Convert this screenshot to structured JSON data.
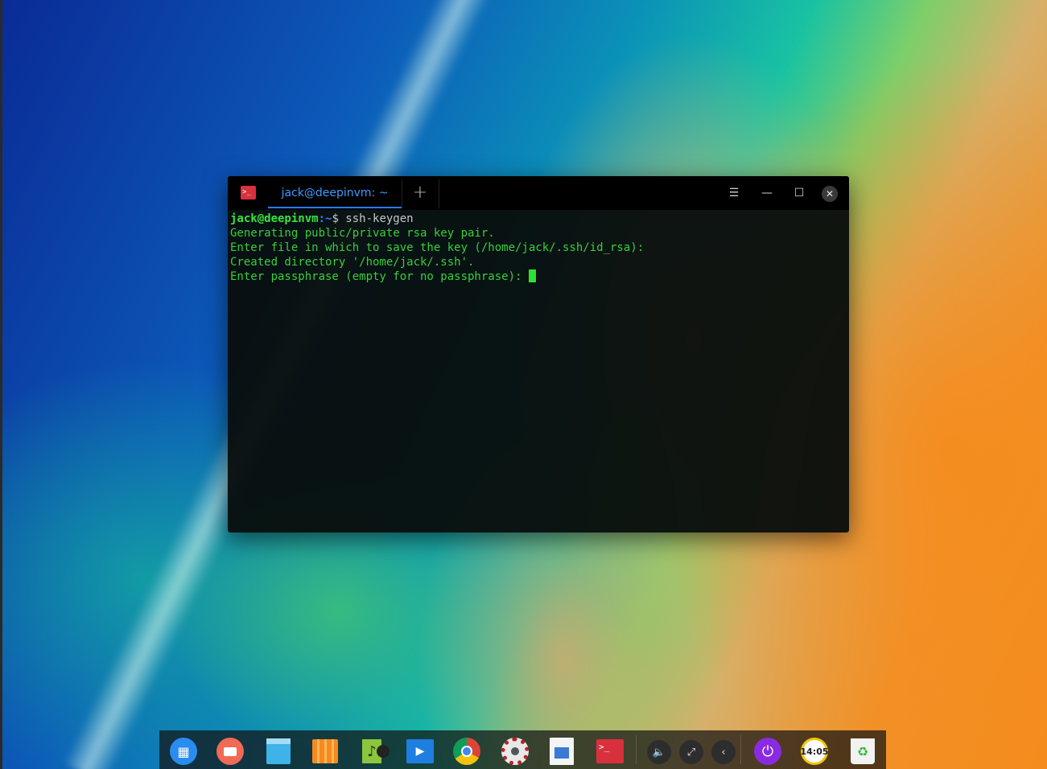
{
  "terminal": {
    "tab_title": "jack@deepinvm: ~",
    "new_tab_label": "+",
    "controls": {
      "menu": "☰",
      "minimize": "—",
      "maximize": "☐",
      "close": "✕"
    },
    "prompt": {
      "user_host": "jack@deepinvm",
      "path": ":~",
      "symbol": "$ ",
      "command": "ssh-keygen"
    },
    "output_lines": [
      "Generating public/private rsa key pair.",
      "Enter file in which to save the key (/home/jack/.ssh/id_rsa):",
      "Created directory '/home/jack/.ssh'.",
      "Enter passphrase (empty for no passphrase): "
    ]
  },
  "dock": {
    "clock_text": "14:05",
    "items": [
      {
        "name": "launcher",
        "icon": "grid-icon"
      },
      {
        "name": "multitasking-view",
        "icon": "multitask-icon"
      },
      {
        "name": "file-manager",
        "icon": "folder-icon"
      },
      {
        "name": "app-store",
        "icon": "store-icon"
      },
      {
        "name": "music",
        "icon": "music-icon"
      },
      {
        "name": "movie",
        "icon": "movie-icon"
      },
      {
        "name": "chrome",
        "icon": "chrome-icon"
      },
      {
        "name": "control-center",
        "icon": "gear-icon"
      },
      {
        "name": "image-viewer",
        "icon": "image-viewer-icon"
      },
      {
        "name": "terminal",
        "icon": "terminal-icon"
      },
      {
        "name": "volume",
        "icon": "volume-icon"
      },
      {
        "name": "network",
        "icon": "network-icon"
      },
      {
        "name": "collapse-tray",
        "icon": "chevron-left-icon"
      },
      {
        "name": "power",
        "icon": "power-icon"
      },
      {
        "name": "clock",
        "icon": "clock-icon"
      },
      {
        "name": "trash",
        "icon": "trash-icon"
      }
    ]
  },
  "colors": {
    "terminal_text": "#37d039",
    "prompt_path": "#3c7cf0",
    "tab_active": "#3d9bff",
    "terminal_icon": "#d9303e"
  }
}
